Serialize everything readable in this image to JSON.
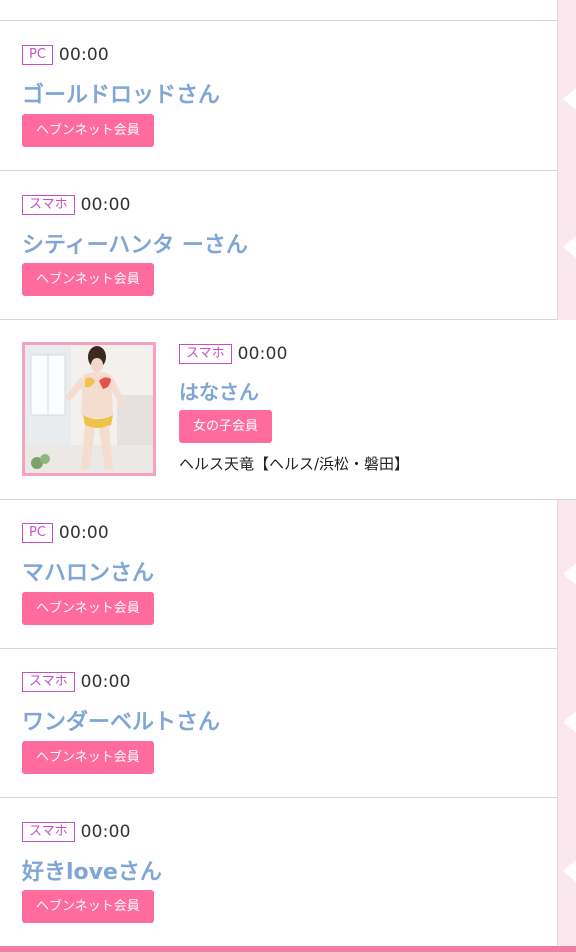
{
  "theme": {
    "accent": "#ff6b9d",
    "name_color": "#7fa6d6",
    "device_badge_color": "#c74fc4",
    "side_strip": "#fbe8ee"
  },
  "entries": [
    {
      "device": "PC",
      "time": "00:00",
      "name": "ゴールドロッドさん",
      "member": "ヘブンネット会員"
    },
    {
      "device": "スマホ",
      "time": "00:00",
      "name": "シティーハンタ ーさん",
      "member": "ヘブンネット会員"
    },
    {
      "device": "スマホ",
      "time": "00:00",
      "name": "はなさん",
      "member": "女の子会員",
      "shop": "ヘルス天竜【ヘルス/浜松・磐田】",
      "thumbnail": "profile-photo"
    },
    {
      "device": "PC",
      "time": "00:00",
      "name": "マハロンさん",
      "member": "ヘブンネット会員"
    },
    {
      "device": "スマホ",
      "time": "00:00",
      "name": "ワンダーベルトさん",
      "member": "ヘブンネット会員"
    },
    {
      "device": "スマホ",
      "time": "00:00",
      "name": "好きloveさん",
      "member": "ヘブンネット会員"
    }
  ]
}
